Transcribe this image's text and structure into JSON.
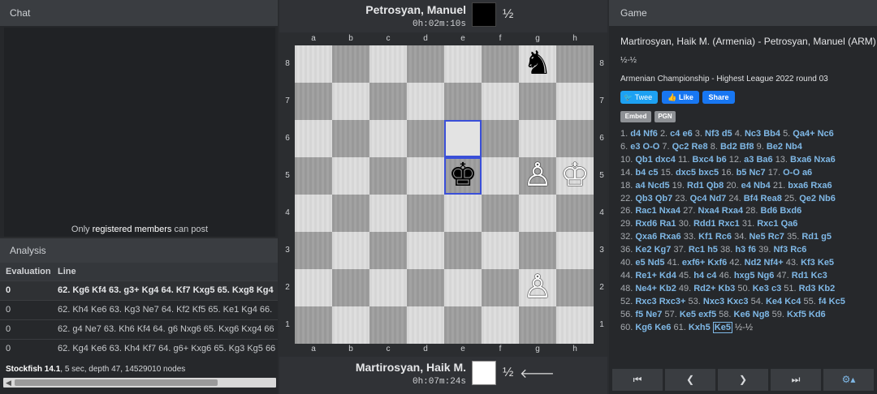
{
  "chat": {
    "title": "Chat",
    "note_prefix": "Only ",
    "note_link": "registered members",
    "note_suffix": " can post"
  },
  "analysis": {
    "title": "Analysis",
    "col_eval": "Evaluation",
    "col_line": "Line",
    "rows": [
      {
        "eval": "0",
        "line": "62. Kg6 Kf4 63. g3+ Kg4 64. Kf7 Kxg5 65. Kxg8 Kg4"
      },
      {
        "eval": "0",
        "line": "62. Kh4 Ke6 63. Kg3 Ne7 64. Kf2 Kf5 65. Ke1 Kg4 66."
      },
      {
        "eval": "0",
        "line": "62. g4 Ne7 63. Kh6 Kf4 64. g6 Nxg6 65. Kxg6 Kxg4 66"
      },
      {
        "eval": "0",
        "line": "62. Kg4 Ke6 63. Kh4 Kf7 64. g6+ Kxg6 65. Kg3 Kg5 66"
      }
    ],
    "engine": "Stockfish 14.1",
    "engine_info": ", 5 sec, depth 47, 14529010 nodes"
  },
  "top_player": {
    "name": "Petrosyan, Manuel",
    "clock": "0h:02m:10s",
    "result": "½"
  },
  "bottom_player": {
    "name": "Martirosyan, Haik M.",
    "clock": "0h:07m:24s",
    "result": "½",
    "to_move_icon": "arrow-left-icon"
  },
  "board": {
    "files": [
      "a",
      "b",
      "c",
      "d",
      "e",
      "f",
      "g",
      "h"
    ],
    "ranks": [
      "8",
      "7",
      "6",
      "5",
      "4",
      "3",
      "2",
      "1"
    ],
    "pieces": [
      {
        "square": "g8",
        "glyph": "♞",
        "color": "b",
        "name": "black-knight"
      },
      {
        "square": "e5",
        "glyph": "♚",
        "color": "b",
        "name": "black-king"
      },
      {
        "square": "g5",
        "glyph": "♙",
        "color": "w",
        "name": "white-pawn"
      },
      {
        "square": "h5",
        "glyph": "♔",
        "color": "w",
        "name": "white-king"
      },
      {
        "square": "g2",
        "glyph": "♙",
        "color": "w",
        "name": "white-pawn"
      }
    ],
    "last_move_from": "e6",
    "last_move_to": "e5"
  },
  "game": {
    "title": "Game",
    "players": "Martirosyan, Haik M. (Armenia) - Petrosyan, Manuel (ARM)",
    "result": "½-½",
    "event": "Armenian Championship - Highest League 2022",
    "round": " round 03",
    "tweet_label": "Twee",
    "like_label": "Like",
    "share_label": "Share",
    "embed_label": "Embed",
    "pgn_label": "PGN",
    "final_result": "½-½",
    "moves": [
      [
        "1.",
        "d4",
        "Nf6"
      ],
      [
        "2.",
        "c4",
        "e6"
      ],
      [
        "3.",
        "Nf3",
        "d5"
      ],
      [
        "4.",
        "Nc3",
        "Bb4"
      ],
      [
        "5.",
        "Qa4+",
        "Nc6"
      ],
      [
        "6.",
        "e3",
        "O-O"
      ],
      [
        "7.",
        "Qc2",
        "Re8"
      ],
      [
        "8.",
        "Bd2",
        "Bf8"
      ],
      [
        "9.",
        "Be2",
        "Nb4"
      ],
      [
        "10.",
        "Qb1",
        "dxc4"
      ],
      [
        "11.",
        "Bxc4",
        "b6"
      ],
      [
        "12.",
        "a3",
        "Ba6"
      ],
      [
        "13.",
        "Bxa6",
        "Nxa6"
      ],
      [
        "14.",
        "b4",
        "c5"
      ],
      [
        "15.",
        "dxc5",
        "bxc5"
      ],
      [
        "16.",
        "b5",
        "Nc7"
      ],
      [
        "17.",
        "O-O",
        "a6"
      ],
      [
        "18.",
        "a4",
        "Ncd5"
      ],
      [
        "19.",
        "Rd1",
        "Qb8"
      ],
      [
        "20.",
        "e4",
        "Nb4"
      ],
      [
        "21.",
        "bxa6",
        "Rxa6"
      ],
      [
        "22.",
        "Qb3",
        "Qb7"
      ],
      [
        "23.",
        "Qc4",
        "Nd7"
      ],
      [
        "24.",
        "Bf4",
        "Rea8"
      ],
      [
        "25.",
        "Qe2",
        "Nb6"
      ],
      [
        "26.",
        "Rac1",
        "Nxa4"
      ],
      [
        "27.",
        "Nxa4",
        "Rxa4"
      ],
      [
        "28.",
        "Bd6",
        "Bxd6"
      ],
      [
        "29.",
        "Rxd6",
        "Ra1"
      ],
      [
        "30.",
        "Rdd1",
        "Rxc1"
      ],
      [
        "31.",
        "Rxc1",
        "Qa6"
      ],
      [
        "32.",
        "Qxa6",
        "Rxa6"
      ],
      [
        "33.",
        "Kf1",
        "Rc6"
      ],
      [
        "34.",
        "Ne5",
        "Rc7"
      ],
      [
        "35.",
        "Rd1",
        "g5"
      ],
      [
        "36.",
        "Ke2",
        "Kg7"
      ],
      [
        "37.",
        "Rc1",
        "h5"
      ],
      [
        "38.",
        "h3",
        "f6"
      ],
      [
        "39.",
        "Nf3",
        "Rc6"
      ],
      [
        "40.",
        "e5",
        "Nd5"
      ],
      [
        "41.",
        "exf6+",
        "Kxf6"
      ],
      [
        "42.",
        "Nd2",
        "Nf4+"
      ],
      [
        "43.",
        "Kf3",
        "Ke5"
      ],
      [
        "44.",
        "Re1+",
        "Kd4"
      ],
      [
        "45.",
        "h4",
        "c4"
      ],
      [
        "46.",
        "hxg5",
        "Ng6"
      ],
      [
        "47.",
        "Rd1",
        "Kc3"
      ],
      [
        "48.",
        "Ne4+",
        "Kb2"
      ],
      [
        "49.",
        "Rd2+",
        "Kb3"
      ],
      [
        "50.",
        "Ke3",
        "c3"
      ],
      [
        "51.",
        "Rd3",
        "Kb2"
      ],
      [
        "52.",
        "Rxc3",
        "Rxc3+"
      ],
      [
        "53.",
        "Nxc3",
        "Kxc3"
      ],
      [
        "54.",
        "Ke4",
        "Kc4"
      ],
      [
        "55.",
        "f4",
        "Kc5"
      ],
      [
        "56.",
        "f5",
        "Ne7"
      ],
      [
        "57.",
        "Ke5",
        "exf5"
      ],
      [
        "58.",
        "Ke6",
        "Ng8"
      ],
      [
        "59.",
        "Kxf5",
        "Kd6"
      ],
      [
        "60.",
        "Kg6",
        "Ke6"
      ],
      [
        "61.",
        "Kxh5",
        "Ke5"
      ]
    ],
    "line_breaks_after": [
      5,
      9,
      13,
      17,
      21,
      25,
      28,
      31,
      35,
      39,
      43,
      47,
      51,
      55,
      59
    ],
    "nav": [
      "first-move-icon",
      "prev-move-icon",
      "next-move-icon",
      "last-move-icon",
      "settings-icon"
    ]
  }
}
